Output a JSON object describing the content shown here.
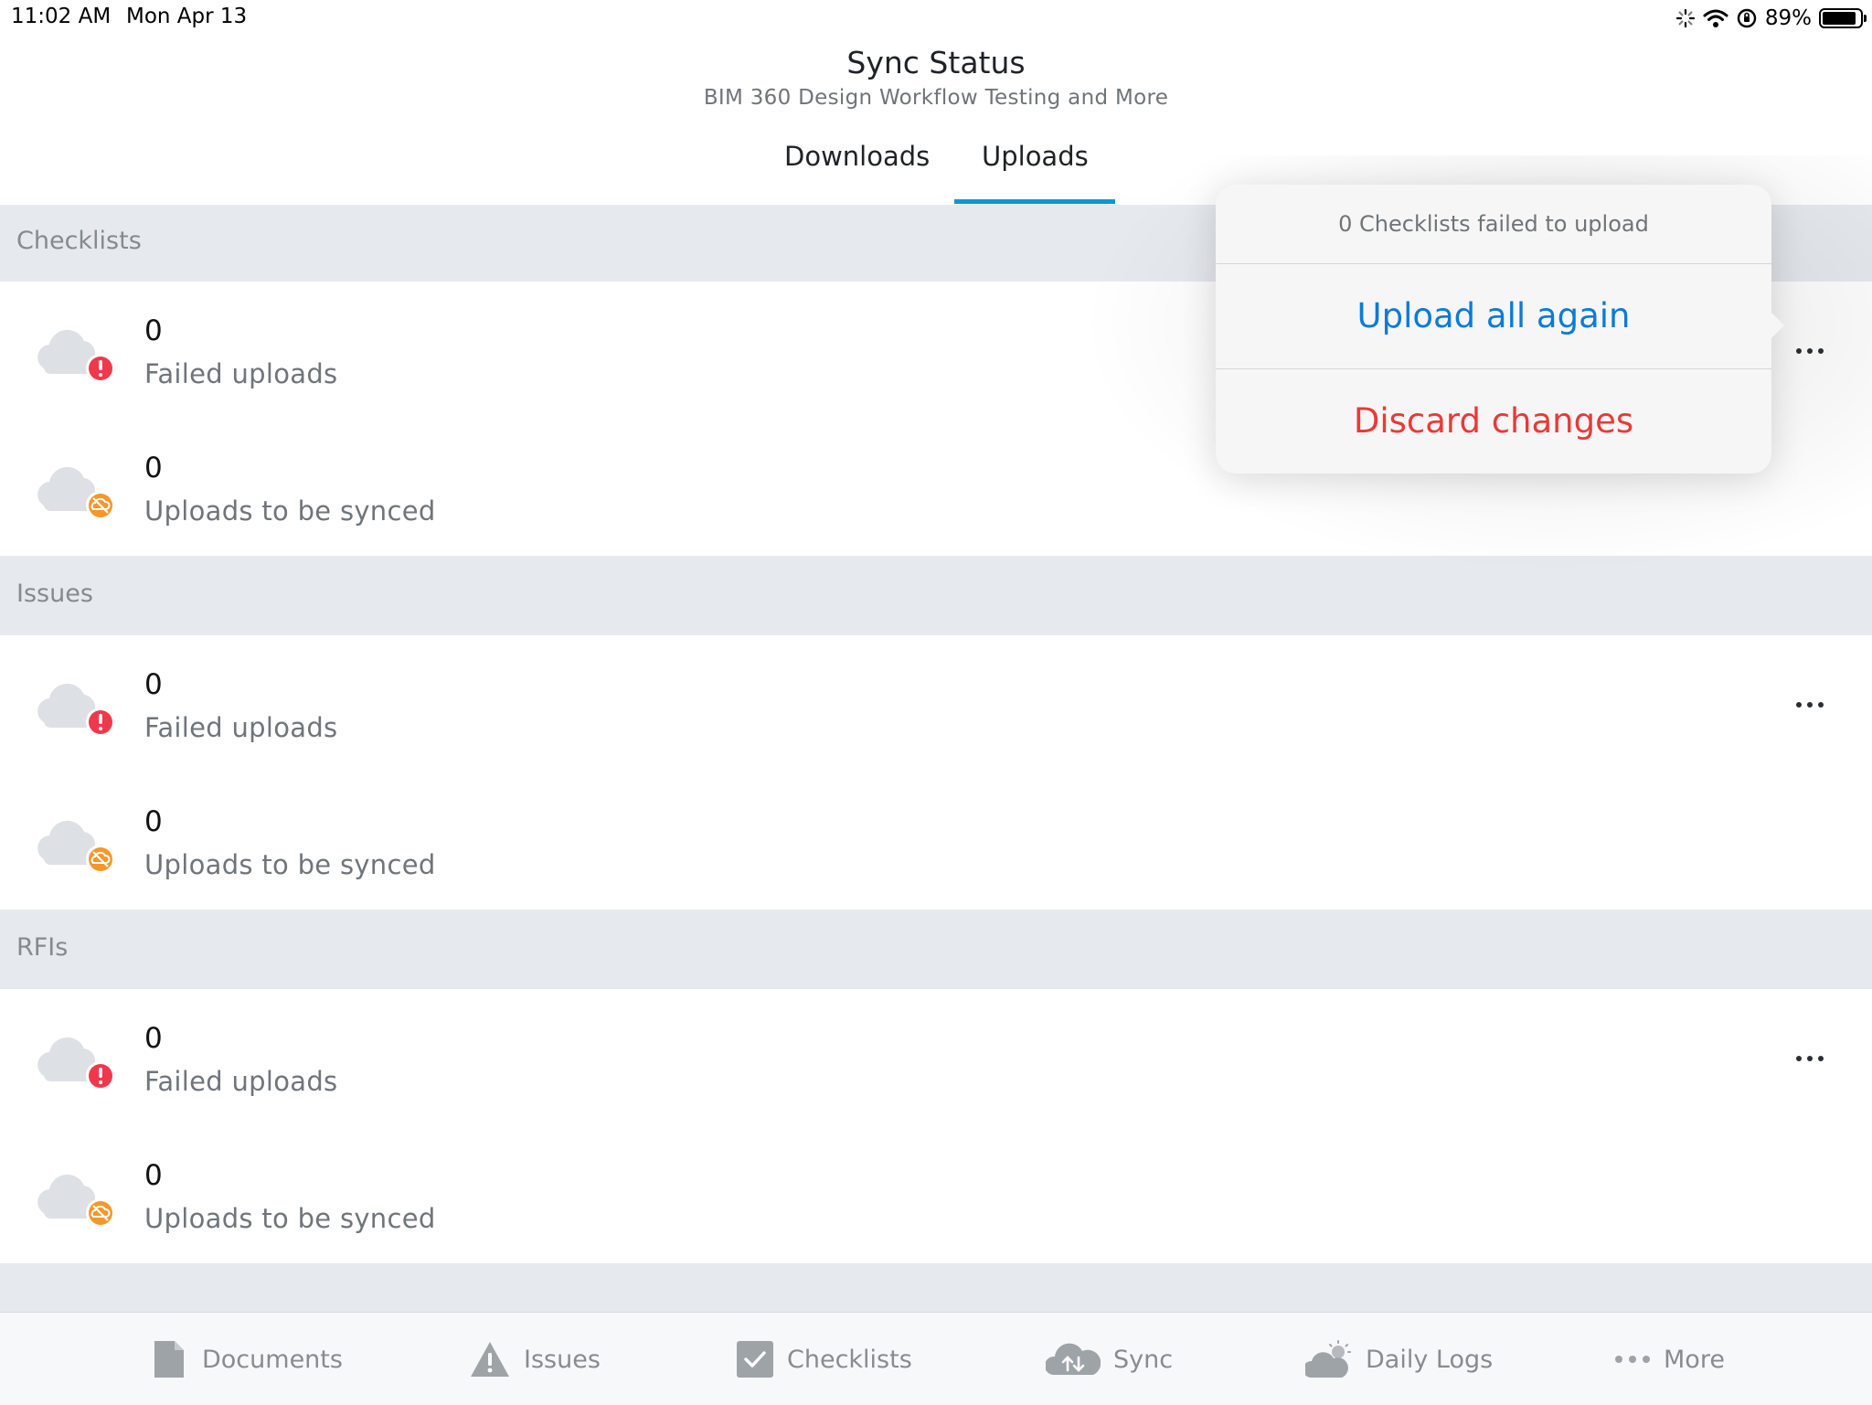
{
  "status_bar": {
    "time": "11:02 AM",
    "date": "Mon Apr 13",
    "battery_pct": "89%",
    "battery_level": 0.89
  },
  "header": {
    "title": "Sync Status",
    "subtitle": "BIM 360 Design Workflow Testing and More",
    "tabs": [
      {
        "label": "Downloads"
      },
      {
        "label": "Uploads"
      }
    ],
    "active_tab": "Uploads"
  },
  "sections": [
    {
      "title": "Checklists",
      "failed": {
        "count": "0",
        "label": "Failed uploads"
      },
      "pending": {
        "count": "0",
        "label": "Uploads to be synced"
      }
    },
    {
      "title": "Issues",
      "failed": {
        "count": "0",
        "label": "Failed uploads"
      },
      "pending": {
        "count": "0",
        "label": "Uploads to be synced"
      }
    },
    {
      "title": "RFIs",
      "failed": {
        "count": "0",
        "label": "Failed uploads"
      },
      "pending": {
        "count": "0",
        "label": "Uploads to be synced"
      }
    }
  ],
  "popover": {
    "title": "0 Checklists failed to upload",
    "upload_label": "Upload all again",
    "discard_label": "Discard changes"
  },
  "tabbar": {
    "items": [
      {
        "label": "Documents",
        "icon": "document-icon"
      },
      {
        "label": "Issues",
        "icon": "warning-icon"
      },
      {
        "label": "Checklists",
        "icon": "checkbox-icon"
      },
      {
        "label": "Sync",
        "icon": "cloud-sync-icon"
      },
      {
        "label": "Daily Logs",
        "icon": "weather-icon"
      },
      {
        "label": "More",
        "icon": "ellipsis-icon"
      }
    ]
  },
  "colors": {
    "accent": "#0b96d4",
    "link_blue": "#0a7bd8",
    "destructive_red": "#ea3a35",
    "error_badge": "#f0384b",
    "sync_badge": "#f5972a",
    "section_bg": "#e6eaee"
  }
}
